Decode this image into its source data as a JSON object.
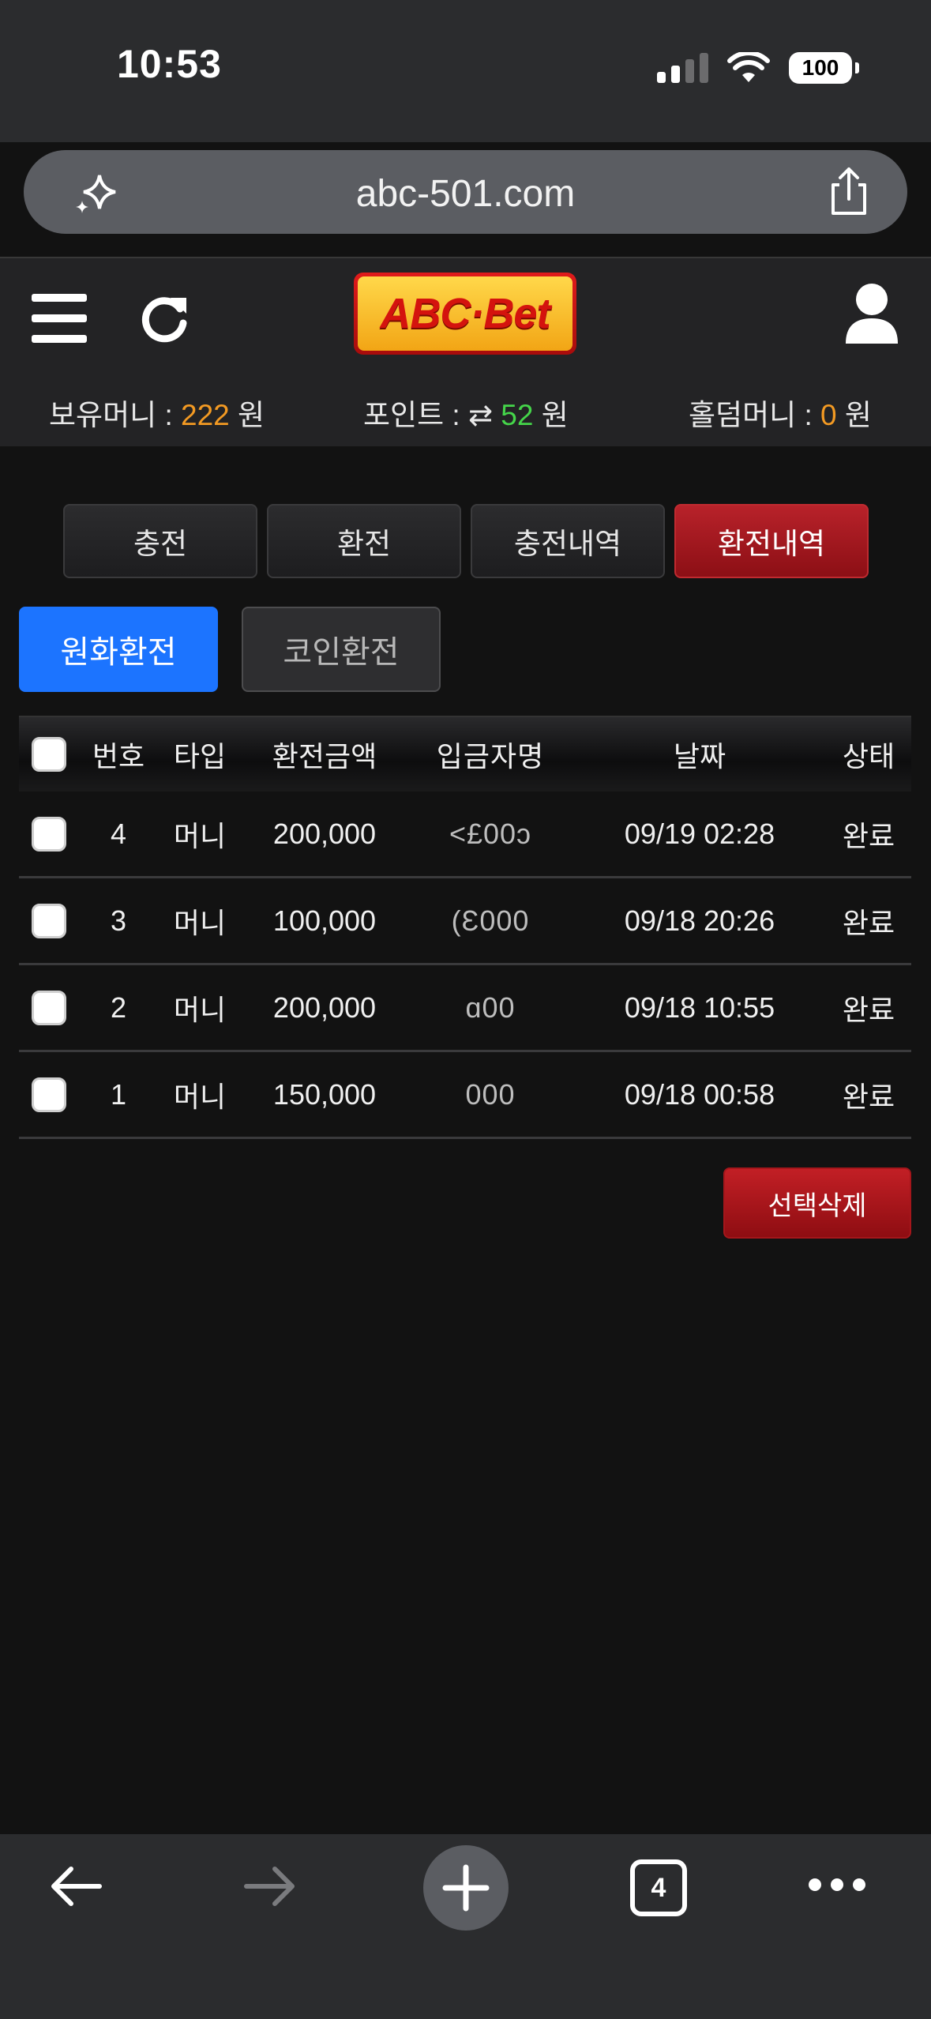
{
  "status_bar": {
    "time": "10:53",
    "battery": "100"
  },
  "browser": {
    "url": "abc-501.com",
    "open_tabs_count": "4"
  },
  "site": {
    "logo_text": "ABC·Bet",
    "balances": {
      "money_label": "보유머니 : ",
      "money_value": "222",
      "point_label": "포인트 : ",
      "point_value": "52",
      "holdem_label": "홀덤머니 : ",
      "holdem_value": "0",
      "unit": "원"
    }
  },
  "tabs": [
    {
      "label": "충전",
      "active": false
    },
    {
      "label": "환전",
      "active": false
    },
    {
      "label": "충전내역",
      "active": false
    },
    {
      "label": "환전내역",
      "active": true
    }
  ],
  "subtabs": [
    {
      "label": "원화환전",
      "active": true
    },
    {
      "label": "코인환전",
      "active": false
    }
  ],
  "table": {
    "headers": [
      "번호",
      "타입",
      "환전금액",
      "입금자명",
      "날짜",
      "상태"
    ],
    "rows": [
      {
        "no": "4",
        "type": "머니",
        "amount": "200,000",
        "name": "<£00ɔ",
        "date": "09/19 02:28",
        "status": "완료"
      },
      {
        "no": "3",
        "type": "머니",
        "amount": "100,000",
        "name": "(Ɛ000",
        "date": "09/18 20:26",
        "status": "완료"
      },
      {
        "no": "2",
        "type": "머니",
        "amount": "200,000",
        "name": "ɑ00",
        "date": "09/18 10:55",
        "status": "완료"
      },
      {
        "no": "1",
        "type": "머니",
        "amount": "150,000",
        "name": "000",
        "date": "09/18 00:58",
        "status": "완료"
      }
    ]
  },
  "actions": {
    "delete_selected": "선택삭제"
  },
  "colors": {
    "accent_blue": "#1c74ff",
    "accent_red": "#8c0f15",
    "money_orange": "#f39a23",
    "point_green": "#45d54a"
  }
}
